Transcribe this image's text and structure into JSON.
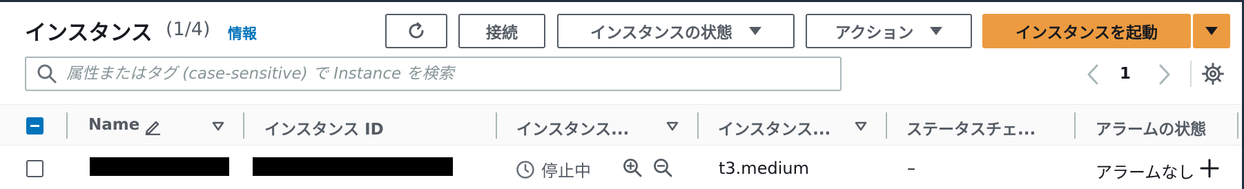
{
  "header": {
    "title": "インスタンス",
    "count": "(1/4)",
    "info_link": "情報"
  },
  "toolbar": {
    "refresh_icon": "refresh-icon",
    "connect_label": "接続",
    "instance_state_label": "インスタンスの状態",
    "actions_label": "アクション",
    "launch_label": "インスタンスを起動",
    "accent_color": "#ec9b41"
  },
  "search": {
    "placeholder": "属性またはタグ (case-sensitive) で Instance を検索"
  },
  "pagination": {
    "current_page": "1"
  },
  "table": {
    "columns": [
      {
        "label": "Name",
        "editable": true,
        "sortable": true
      },
      {
        "label": "インスタンス ID",
        "sortable": false
      },
      {
        "label": "インスタンス...",
        "sortable": true
      },
      {
        "label": "インスタンス...",
        "sortable": true
      },
      {
        "label": "ステータスチェ...",
        "sortable": false
      },
      {
        "label": "アラームの状態",
        "sortable": false
      }
    ],
    "header_checkbox_state": "indeterminate",
    "rows": [
      {
        "selected": false,
        "name": "[redacted]",
        "instance_id": "[redacted]",
        "state": "停止中",
        "instance_type": "t3.medium",
        "status_check": "–",
        "alarm_state": "アラームなし"
      }
    ]
  }
}
